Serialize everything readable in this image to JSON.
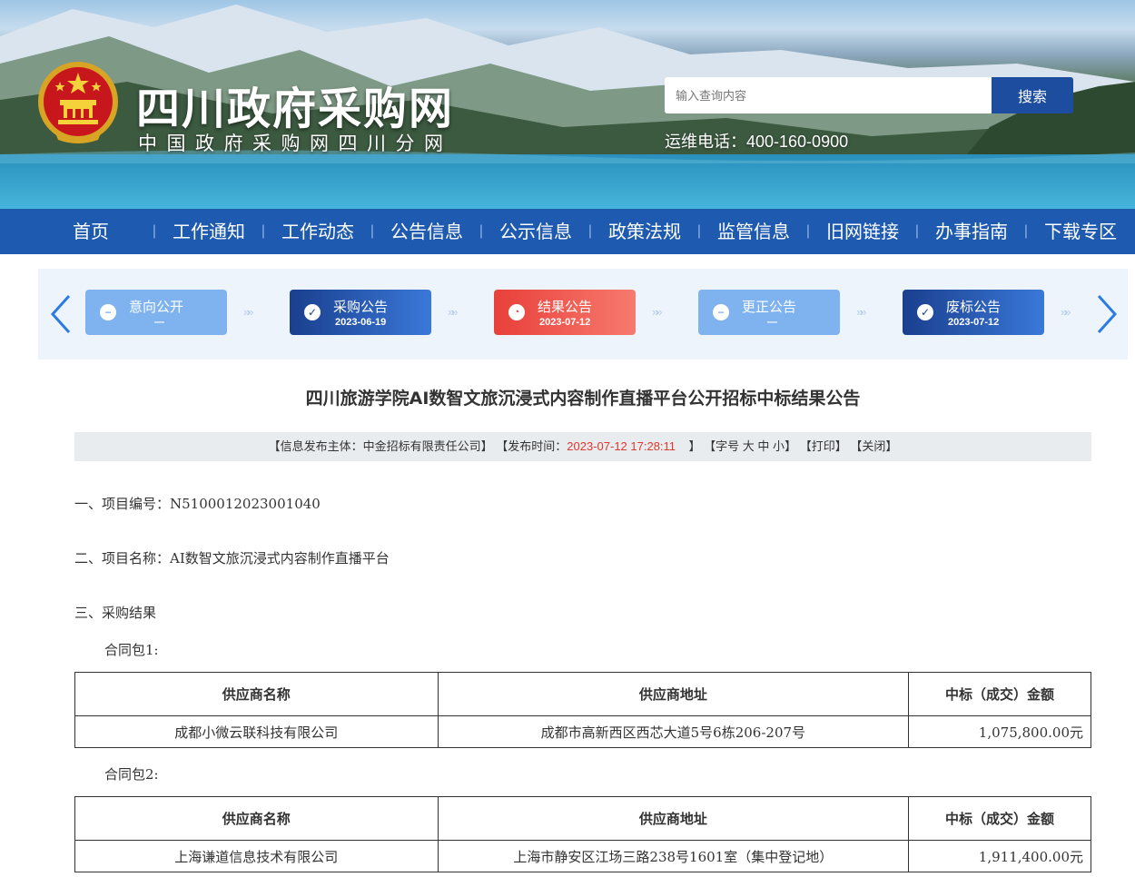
{
  "header": {
    "site_title": "四川政府采购网",
    "site_subtitle": "中国政府采购网四川分网",
    "search_placeholder": "输入查询内容",
    "search_button": "搜索",
    "hotline": "运维电话：400-160-0900"
  },
  "nav": {
    "items": [
      "首页",
      "工作通知",
      "工作动态",
      "公告信息",
      "公示信息",
      "政策法规",
      "监管信息",
      "旧网链接",
      "办事指南",
      "下载专区"
    ],
    "separator": "|"
  },
  "steps": [
    {
      "label": "意向公开",
      "date": "—",
      "state": "inactive",
      "icon": "minus-icon"
    },
    {
      "label": "采购公告",
      "date": "2023-06-19",
      "state": "done",
      "icon": "check-icon"
    },
    {
      "label": "结果公告",
      "date": "2023-07-12",
      "state": "current",
      "icon": "clock-icon"
    },
    {
      "label": "更正公告",
      "date": "—",
      "state": "inactive",
      "icon": "minus-icon"
    },
    {
      "label": "废标公告",
      "date": "2023-07-12",
      "state": "done",
      "icon": "check-icon"
    }
  ],
  "article": {
    "title": "四川旅游学院AI数智文旅沉浸式内容制作直播平台公开招标中标结果公告",
    "meta": {
      "publisher": "【信息发布主体：中金招标有限责任公司】",
      "time_label": "【发布时间：",
      "time_value": "2023-07-12 17:28:11",
      "time_close": "】",
      "font_size_label": "【字号",
      "font_large": "大",
      "font_medium": "中",
      "font_small": "小",
      "font_close": "】",
      "print": "【打印】",
      "close": "【关闭】"
    },
    "sections": {
      "project_no": "一、项目编号：N5100012023001040",
      "project_name": "二、项目名称：AI数智文旅沉浸式内容制作直播平台",
      "result": "三、采购结果"
    },
    "packages": [
      {
        "label": "合同包1:",
        "headers": [
          "供应商名称",
          "供应商地址",
          "中标（成交）金额"
        ],
        "rows": [
          [
            "成都小微云联科技有限公司",
            "成都市高新西区西芯大道5号6栋206-207号",
            "1,075,800.00元"
          ]
        ]
      },
      {
        "label": "合同包2:",
        "headers": [
          "供应商名称",
          "供应商地址",
          "中标（成交）金额"
        ],
        "rows": [
          [
            "上海谦道信息技术有限公司",
            "上海市静安区江场三路238号1601室（集中登记地）",
            "1,911,400.00元"
          ]
        ]
      }
    ]
  },
  "colors": {
    "nav_bg": "#1e5ab0",
    "search_btn": "#1d4d9e",
    "step_current": "#e8403a",
    "step_done": "#1a3f8e",
    "step_inactive": "#7fb3f0",
    "time_red": "#e0362c"
  }
}
